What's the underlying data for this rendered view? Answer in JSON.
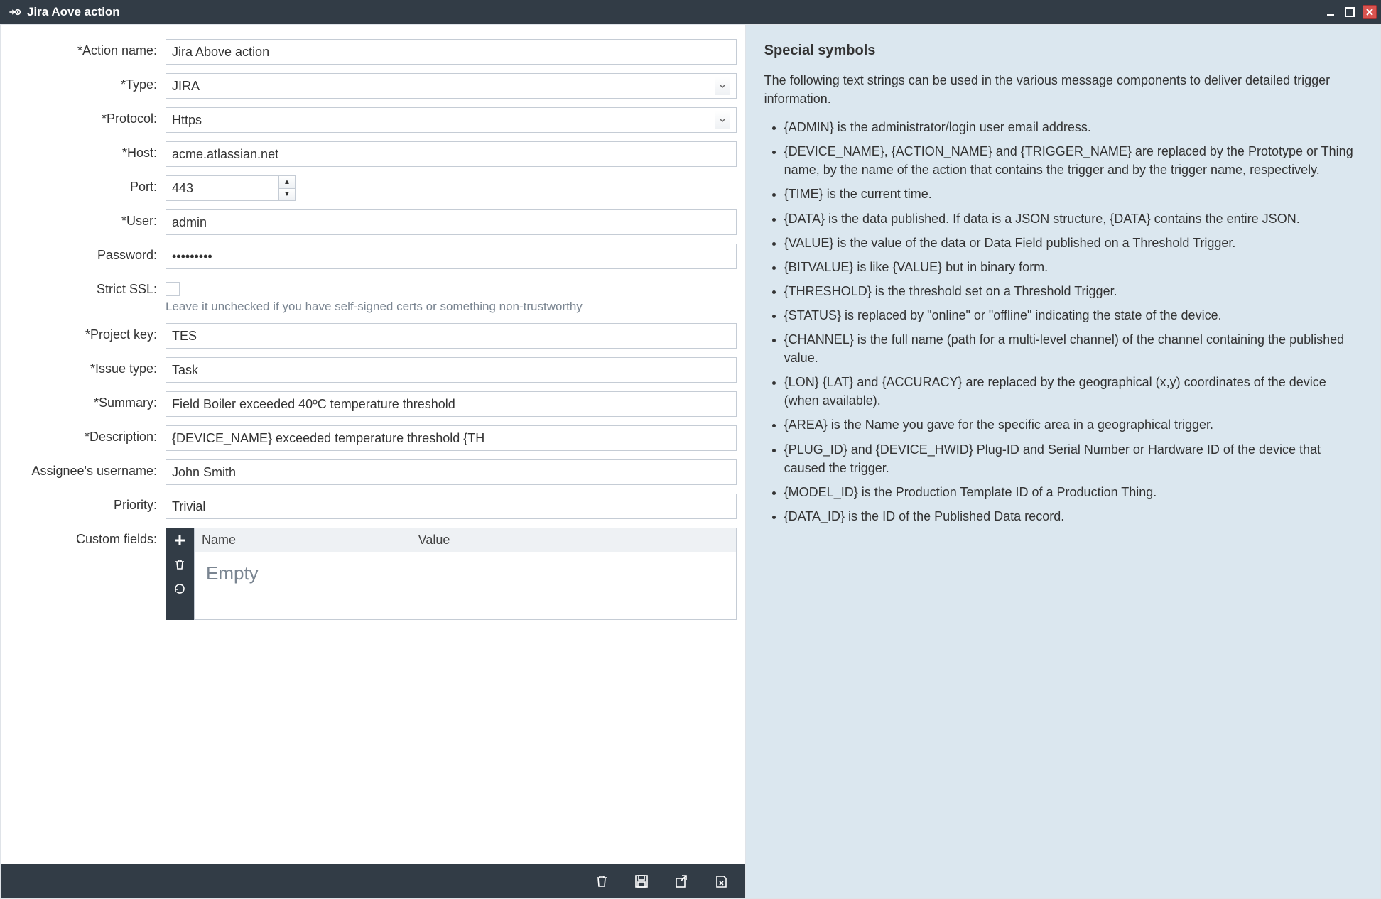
{
  "window": {
    "title": "Jira Aove action"
  },
  "form": {
    "action_name": {
      "label": "*Action name:",
      "value": "Jira Above action"
    },
    "type": {
      "label": "*Type:",
      "value": "JIRA"
    },
    "protocol": {
      "label": "*Protocol:",
      "value": "Https"
    },
    "host": {
      "label": "*Host:",
      "value": "acme.atlassian.net"
    },
    "port": {
      "label": "Port:",
      "value": "443"
    },
    "user": {
      "label": "*User:",
      "value": "admin"
    },
    "password": {
      "label": "Password:",
      "value": "•••••••••"
    },
    "strict_ssl": {
      "label": "Strict SSL:",
      "checked": false,
      "hint": "Leave it unchecked if you have self-signed certs or something non-trustworthy"
    },
    "project_key": {
      "label": "*Project key:",
      "value": "TES"
    },
    "issue_type": {
      "label": "*Issue type:",
      "value": "Task"
    },
    "summary": {
      "label": "*Summary:",
      "value": "Field Boiler exceeded 40ºC temperature threshold"
    },
    "description": {
      "label": "*Description:",
      "value": "{DEVICE_NAME} exceeded temperature threshold {TH"
    },
    "assignee": {
      "label": "Assignee's username:",
      "value": "John Smith"
    },
    "priority": {
      "label": "Priority:",
      "value": "Trivial"
    },
    "custom_fields": {
      "label": "Custom fields:",
      "col_name": "Name",
      "col_value": "Value",
      "empty_text": "Empty"
    }
  },
  "help": {
    "heading": "Special symbols",
    "intro": "The following text strings can be used in the various message components to deliver detailed trigger information.",
    "items": [
      "{ADMIN} is the administrator/login user email address.",
      "{DEVICE_NAME}, {ACTION_NAME} and {TRIGGER_NAME} are replaced by the Prototype or Thing name, by the name of the action that contains the trigger and by the trigger name, respectively.",
      "{TIME} is the current time.",
      "{DATA} is the data published. If data is a JSON structure, {DATA} contains the entire JSON.",
      "{VALUE} is the value of the data or Data Field published on a Threshold Trigger.",
      "{BITVALUE} is like {VALUE} but in binary form.",
      "{THRESHOLD} is the threshold set on a Threshold Trigger.",
      "{STATUS} is replaced by \"online\" or \"offline\" indicating the state of the device.",
      "{CHANNEL} is the full name (path for a multi-level channel) of the channel containing the published value.",
      "{LON} {LAT} and {ACCURACY} are replaced by the geographical (x,y) coordinates of the device (when available).",
      "{AREA} is the Name you gave for the specific area in a geographical trigger.",
      "{PLUG_ID} and {DEVICE_HWID} Plug-ID and Serial Number or Hardware ID of the device that caused the trigger.",
      "{MODEL_ID} is the Production Template ID of a Production Thing.",
      "{DATA_ID} is the ID of the Published Data record."
    ]
  }
}
